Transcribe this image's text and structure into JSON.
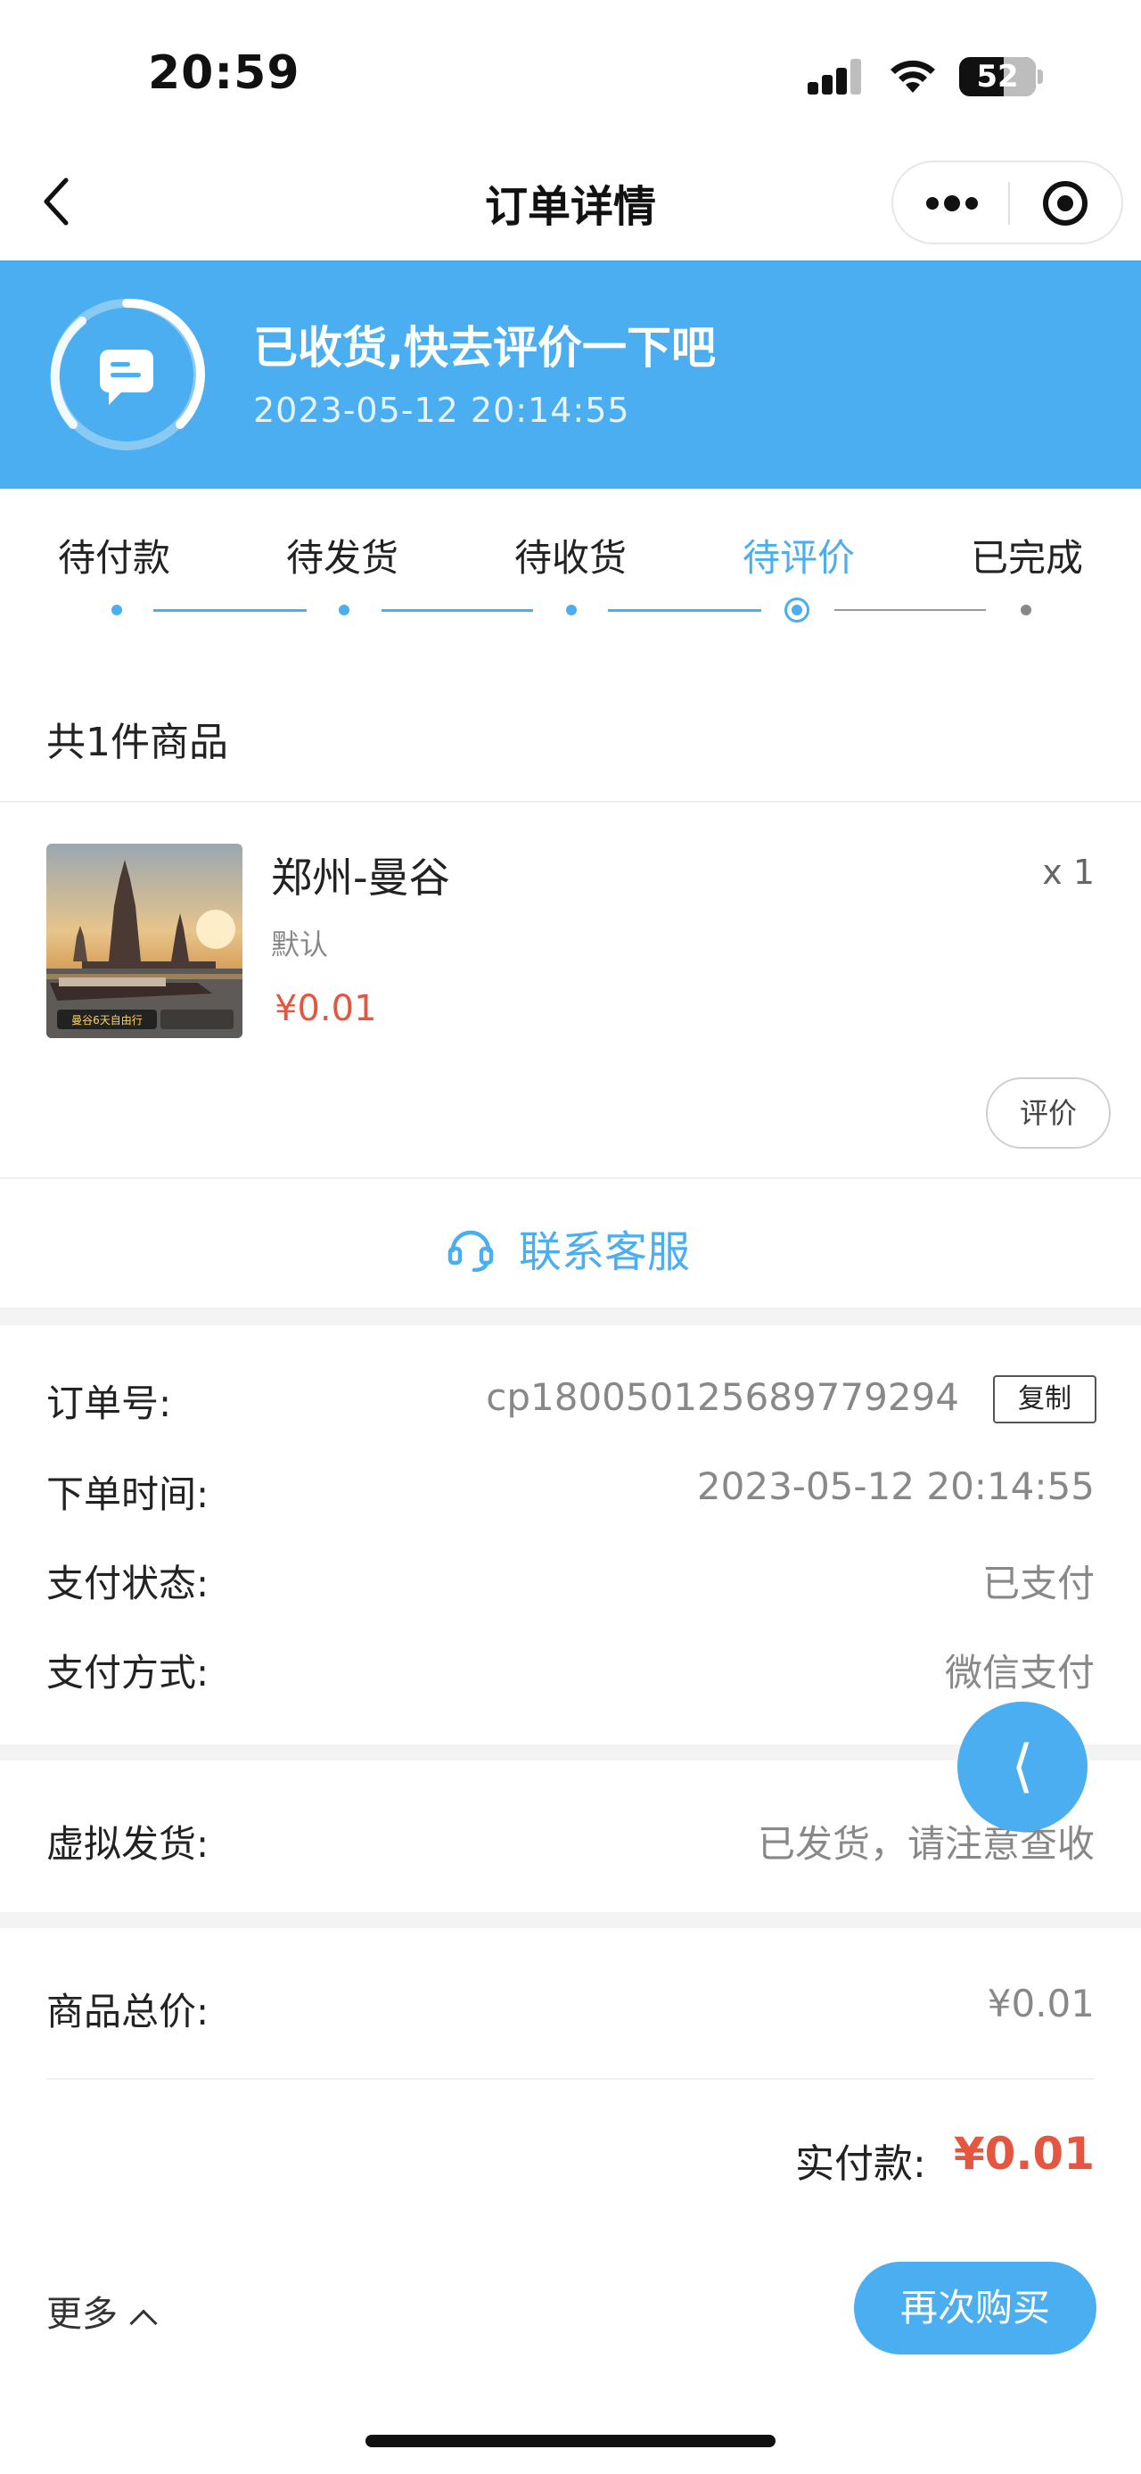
{
  "status_bar": {
    "time": "20:59",
    "battery": "52"
  },
  "nav": {
    "title": "订单详情",
    "back_icon": "chevron-left-icon",
    "more_icon": "more-dots-icon",
    "target_icon": "target-icon"
  },
  "banner": {
    "title": "已收货,快去评价一下吧",
    "time": "2023-05-12   20:14:55",
    "icon": "message-icon",
    "color": "#4aaef0"
  },
  "steps": {
    "items": [
      {
        "label": "待付款",
        "state": "done"
      },
      {
        "label": "待发货",
        "state": "done"
      },
      {
        "label": "待收货",
        "state": "done"
      },
      {
        "label": "待评价",
        "state": "current"
      },
      {
        "label": "已完成",
        "state": "pending"
      }
    ]
  },
  "items": {
    "header": "共1件商品",
    "products": [
      {
        "name": "郑州-曼谷",
        "variant": "默认",
        "price": "¥0.01",
        "quantity": "x 1",
        "review_label": "评价",
        "image_caption": "曼谷6天自由行"
      }
    ]
  },
  "service": {
    "label": "联系客服",
    "icon": "headset-icon"
  },
  "order_info": {
    "order_no_label": "订单号:",
    "order_no": "cp180050125689779294",
    "copy_label": "复制",
    "order_time_label": "下单时间:",
    "order_time": "2023-05-12 20:14:55",
    "pay_status_label": "支付状态:",
    "pay_status": "已支付",
    "pay_method_label": "支付方式:",
    "pay_method": "微信支付"
  },
  "delivery": {
    "label": "虚拟发货:",
    "value": "已发货，请注意查收"
  },
  "totals": {
    "goods_total_label": "商品总价:",
    "goods_total": "¥0.01",
    "paid_label": "实付款:",
    "paid": "¥0.01"
  },
  "footer": {
    "more_label": "更多",
    "rebuy_label": "再次购买"
  },
  "colors": {
    "accent": "#4aaef0",
    "price": "#e5553f"
  }
}
